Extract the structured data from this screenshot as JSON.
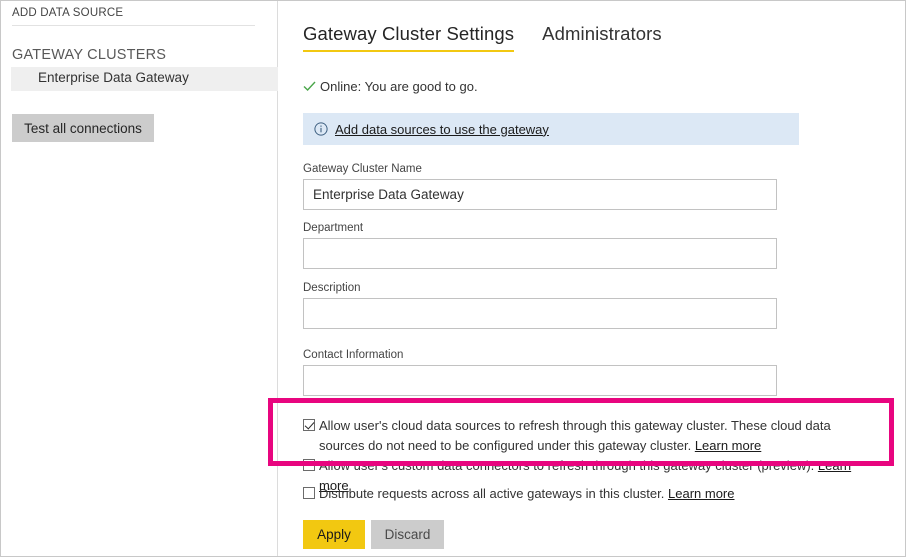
{
  "sidebar": {
    "add_data_source_label": "ADD DATA SOURCE",
    "gateway_clusters_heading": "GATEWAY CLUSTERS",
    "clusters": [
      {
        "name": "Enterprise Data Gateway",
        "selected": true
      }
    ],
    "test_all_connections_label": "Test all connections"
  },
  "main": {
    "tabs": [
      {
        "label": "Gateway Cluster Settings",
        "active": true
      },
      {
        "label": "Administrators",
        "active": false
      }
    ],
    "status": {
      "icon": "check-icon",
      "text": "Online: You are good to go.",
      "color": "#4aa64a"
    },
    "info_banner": {
      "icon": "info-icon",
      "link_text": "Add data sources to use the gateway",
      "background": "#dce8f5"
    },
    "fields": [
      {
        "label": "Gateway Cluster Name",
        "value": "Enterprise Data Gateway",
        "placeholder": "",
        "multiline": false
      },
      {
        "label": "Department",
        "value": "",
        "placeholder": "",
        "multiline": true
      },
      {
        "label": "Description",
        "value": "",
        "placeholder": "",
        "multiline": true
      },
      {
        "label": "Contact Information",
        "value": "",
        "placeholder": "",
        "multiline": true
      }
    ],
    "checkboxes": [
      {
        "checked": true,
        "text": "Allow user's cloud data sources to refresh through this gateway cluster. These cloud data sources do not need to be configured under this gateway cluster.",
        "learn_more": "Learn more"
      },
      {
        "checked": false,
        "text": "Allow user's custom data connectors to refresh through this gateway cluster (preview).",
        "learn_more": "Learn more"
      },
      {
        "checked": false,
        "text": "Distribute requests across all active gateways in this cluster.",
        "learn_more": "Learn more"
      }
    ],
    "actions": {
      "apply_label": "Apply",
      "apply_color": "#f2c811",
      "discard_label": "Discard",
      "discard_color": "#cccccc"
    }
  },
  "annotation": {
    "highlight_color": "#e8057f"
  }
}
